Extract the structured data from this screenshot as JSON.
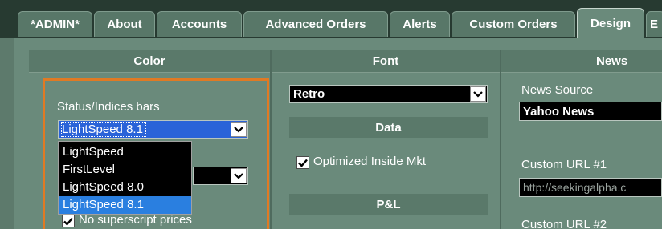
{
  "tabs": [
    {
      "label": "*ADMIN*"
    },
    {
      "label": "About"
    },
    {
      "label": "Accounts"
    },
    {
      "label": "Advanced Orders"
    },
    {
      "label": "Alerts"
    },
    {
      "label": "Custom Orders"
    },
    {
      "label": "Design"
    },
    {
      "label": "E"
    }
  ],
  "active_tab": "Design",
  "columns": {
    "color": "Color",
    "font": "Font",
    "news": "News"
  },
  "color_section": {
    "status_label": "Status/Indices bars",
    "status_value": "LightSpeed 8.1",
    "dropdown_options": [
      "LightSpeed",
      "FirstLevel",
      "LightSpeed 8.0",
      "LightSpeed 8.1"
    ],
    "selected_option": "LightSpeed 8.1",
    "superscript_label": "No superscript prices",
    "superscript_checked": true
  },
  "font_section": {
    "font_value": "Retro",
    "data_heading": "Data",
    "optimized_label": "Optimized Inside Mkt",
    "optimized_checked": true,
    "pl_heading": "P&L"
  },
  "news_section": {
    "source_label": "News Source",
    "source_value": "Yahoo News",
    "custom1_label": "Custom URL #1",
    "custom1_value": "http://seekingalpha.c",
    "custom2_label": "Custom URL #2"
  },
  "colors": {
    "tab_bar": "#273a31",
    "panel": "#6a8a7b",
    "highlight_border": "#e07a24",
    "selection": "#2a7fe0"
  }
}
